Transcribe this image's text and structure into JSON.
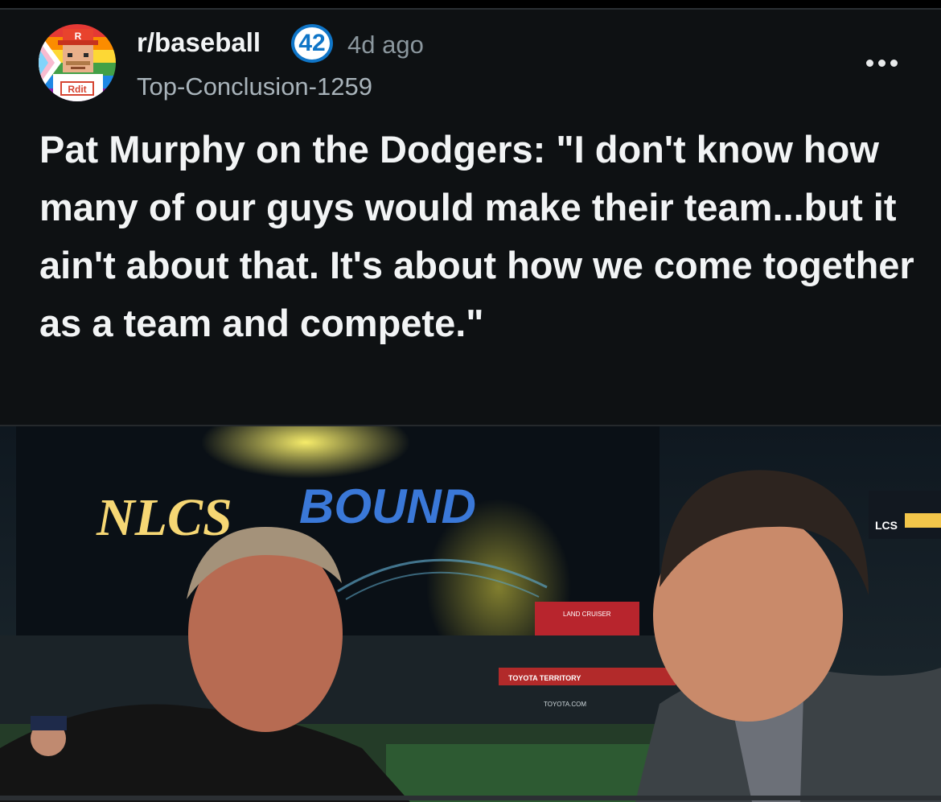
{
  "post": {
    "subreddit": "r/baseball",
    "flair_number": "42",
    "time_ago": "4d ago",
    "author": "Top-Conclusion-1259",
    "title": "Pat Murphy on the Dodgers: \"I don't know how many of our guys would make their team...but it ain't about that. It's about how we come together as a team and compete.\""
  },
  "avatar": {
    "icon": "pixel-mascot-avatar",
    "hat_letter": "R",
    "shirt_text": "Rdit"
  },
  "image": {
    "sign_word_1": "NLCS",
    "sign_word_2": "BOUND",
    "right_sign": "LCS",
    "board_text": "LAND CRUISER",
    "banner_1": "TOYOTA TERRITORY",
    "banner_2": "TOYOTA.COM"
  },
  "colors": {
    "background": "#0e1113",
    "flair_blue": "#0f75c7",
    "text_primary": "#f2f4f5",
    "text_muted": "#8b979e"
  }
}
